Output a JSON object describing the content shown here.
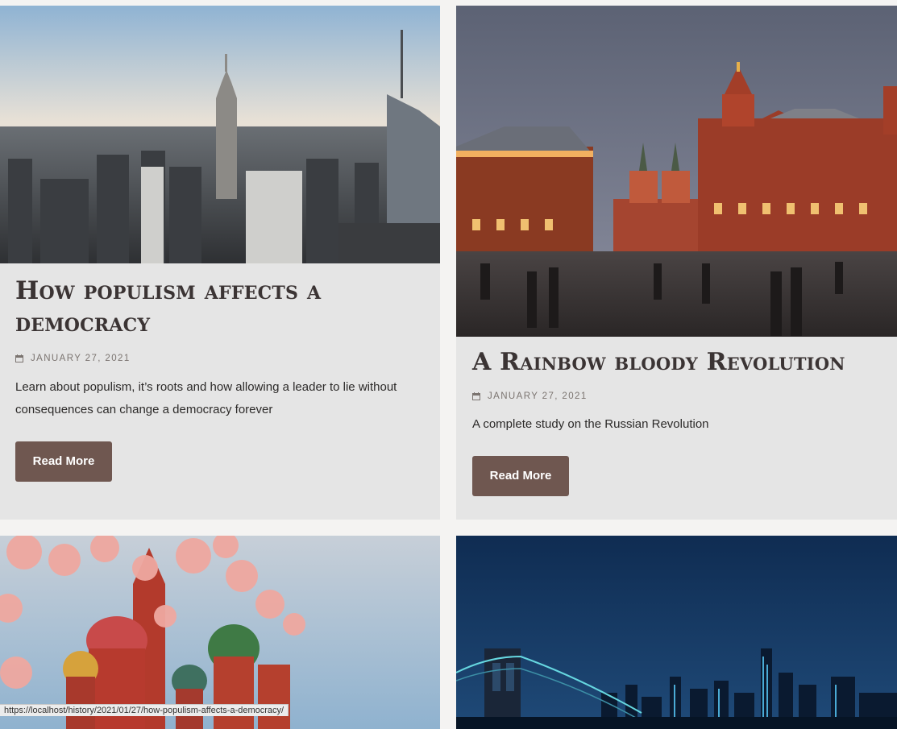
{
  "posts": [
    {
      "title": "How populism affects a democracy",
      "date": "January 27, 2021",
      "excerpt": "Learn about populism, it’s roots and how allowing a leader to lie without consequences can change a democracy forever",
      "button": "Read More",
      "image": "new-york-skyline"
    },
    {
      "title": "A Rainbow bloody Revolution",
      "date": "January 27, 2021",
      "excerpt": "A complete study on the Russian Revolution",
      "button": "Read More",
      "image": "moscow-red-square-dusk"
    },
    {
      "image": "saint-basils-cathedral-with-blossoms"
    },
    {
      "image": "brooklyn-bridge-night-skyline"
    }
  ],
  "status_url": "https://localhost/history/2021/01/27/how-populism-affects-a-democracy/",
  "colors": {
    "card_bg": "#e5e5e5",
    "page_bg": "#f4f3f2",
    "button_bg": "#6f5750",
    "title": "#3b3434"
  }
}
